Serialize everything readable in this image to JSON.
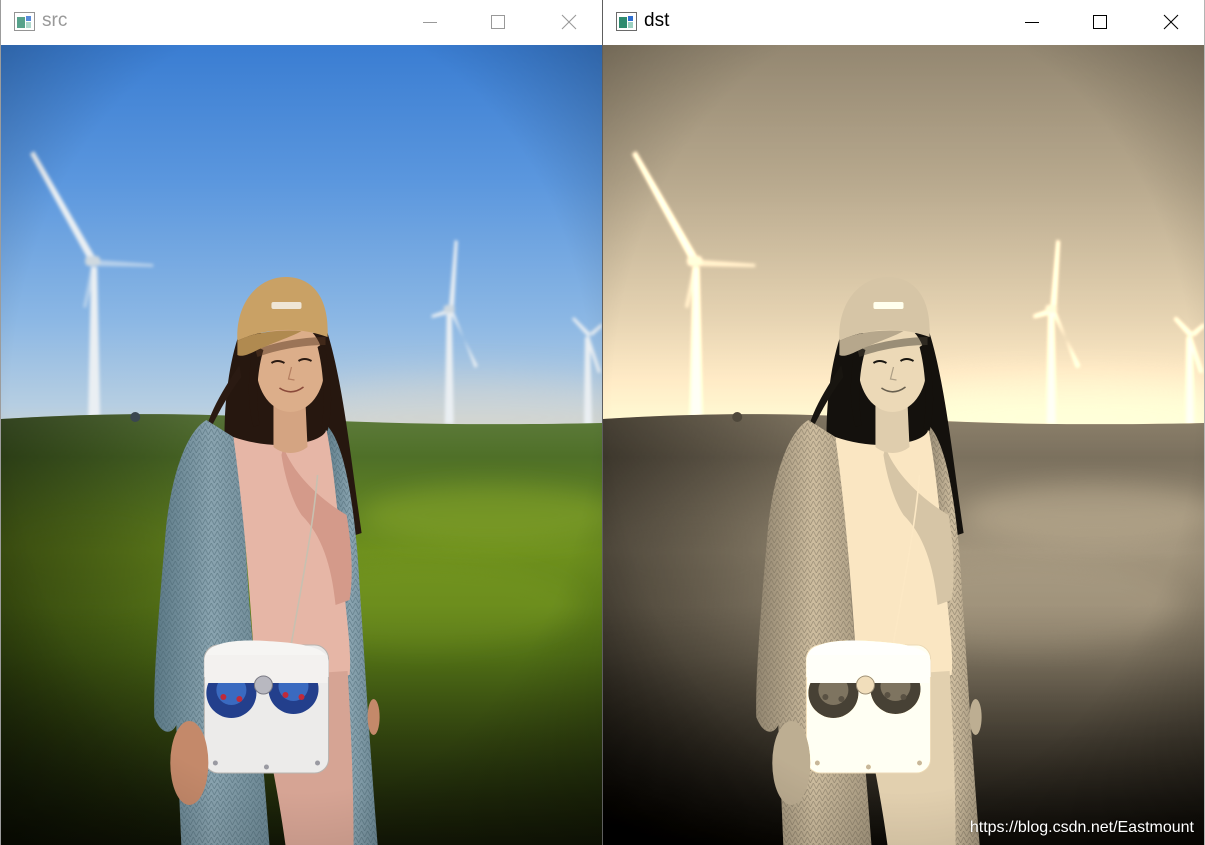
{
  "windows": [
    {
      "title": "src",
      "active": false
    },
    {
      "title": "dst",
      "active": true
    }
  ],
  "icons": {
    "app": "image-window-icon",
    "minimize": "minimize-icon",
    "maximize": "maximize-icon",
    "close": "close-icon"
  },
  "colors": {
    "titlebar_bg": "#ffffff",
    "inactive_text": "#999999",
    "active_text": "#000000",
    "watermark": "#ffffff"
  },
  "watermark": "https://blog.csdn.net/Eastmount"
}
